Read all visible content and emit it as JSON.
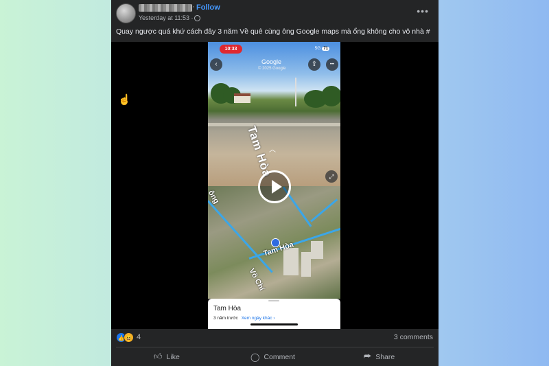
{
  "post": {
    "follow_separator": "·",
    "follow_label": "Follow",
    "timestamp": "Yesterday at 11:53 ·",
    "more_icon": "more-options-icon",
    "more_glyph": "•••",
    "caption": "Quay ngược quá khứ cách đây 3 năm Về quê cùng ông Google maps mà ổng không cho vô nhà  #"
  },
  "video": {
    "status_time": "10:33",
    "signal": "5G",
    "battery": "71",
    "google_label": "Google",
    "google_copy": "© 2025 Google",
    "back_glyph": "‹",
    "share_glyph": "⇪",
    "more_glyph": "•••",
    "expand_glyph": "⤢",
    "road_label": "Tam Hòa",
    "up_chevron": "︿",
    "map_label_road1": "Tam Hòa",
    "map_label_road2": "Võ Chí",
    "map_label_edge": "ông",
    "place_name": "Tam Hòa",
    "place_sub": "3 năm trước",
    "place_link": "Xem ngày khác ›"
  },
  "footer": {
    "reaction_count": "4",
    "comments": "3 comments",
    "like_label": "Like",
    "comment_label": "Comment",
    "share_label": "Share"
  },
  "colors": {
    "accent": "#4599ff",
    "card_bg": "#242526",
    "like": "#1877f2",
    "record": "#e0282f"
  }
}
